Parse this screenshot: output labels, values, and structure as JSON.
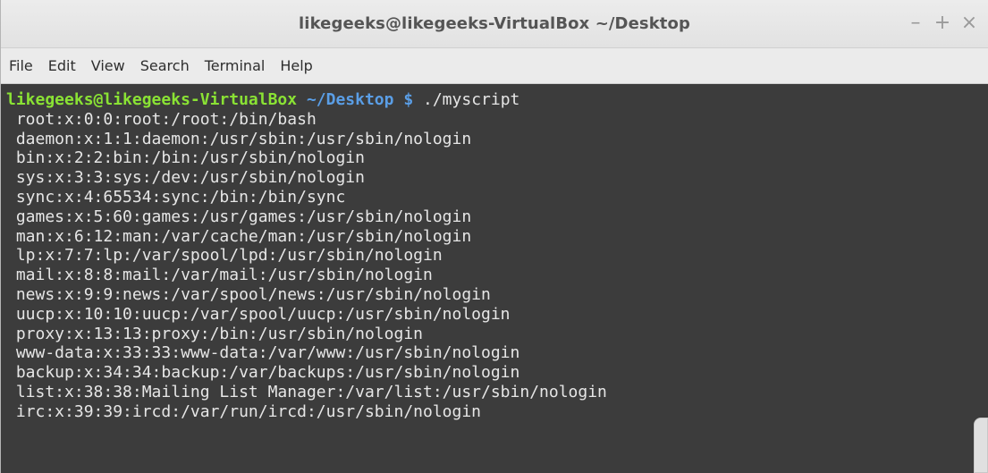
{
  "window": {
    "title": "likegeeks@likegeeks-VirtualBox ~/Desktop",
    "controls": {
      "minimize": "–",
      "maximize": "+",
      "close": "×"
    }
  },
  "menubar": {
    "items": [
      "File",
      "Edit",
      "View",
      "Search",
      "Terminal",
      "Help"
    ]
  },
  "terminal": {
    "prompt": {
      "user_host": "likegeeks@likegeeks-VirtualBox",
      "path": " ~/Desktop",
      "symbol": " $",
      "command": " ./myscript"
    },
    "output_lines": [
      " root:x:0:0:root:/root:/bin/bash",
      " daemon:x:1:1:daemon:/usr/sbin:/usr/sbin/nologin",
      " bin:x:2:2:bin:/bin:/usr/sbin/nologin",
      " sys:x:3:3:sys:/dev:/usr/sbin/nologin",
      " sync:x:4:65534:sync:/bin:/bin/sync",
      " games:x:5:60:games:/usr/games:/usr/sbin/nologin",
      " man:x:6:12:man:/var/cache/man:/usr/sbin/nologin",
      " lp:x:7:7:lp:/var/spool/lpd:/usr/sbin/nologin",
      " mail:x:8:8:mail:/var/mail:/usr/sbin/nologin",
      " news:x:9:9:news:/var/spool/news:/usr/sbin/nologin",
      " uucp:x:10:10:uucp:/var/spool/uucp:/usr/sbin/nologin",
      " proxy:x:13:13:proxy:/bin:/usr/sbin/nologin",
      " www-data:x:33:33:www-data:/var/www:/usr/sbin/nologin",
      " backup:x:34:34:backup:/var/backups:/usr/sbin/nologin",
      " list:x:38:38:Mailing List Manager:/var/list:/usr/sbin/nologin",
      " irc:x:39:39:ircd:/var/run/ircd:/usr/sbin/nologin"
    ]
  },
  "colors": {
    "terminal_background": "#3c3c3c",
    "terminal_text": "#e6e6e6",
    "prompt_user_host": "#8ae234",
    "prompt_path": "#5a9ee6"
  }
}
